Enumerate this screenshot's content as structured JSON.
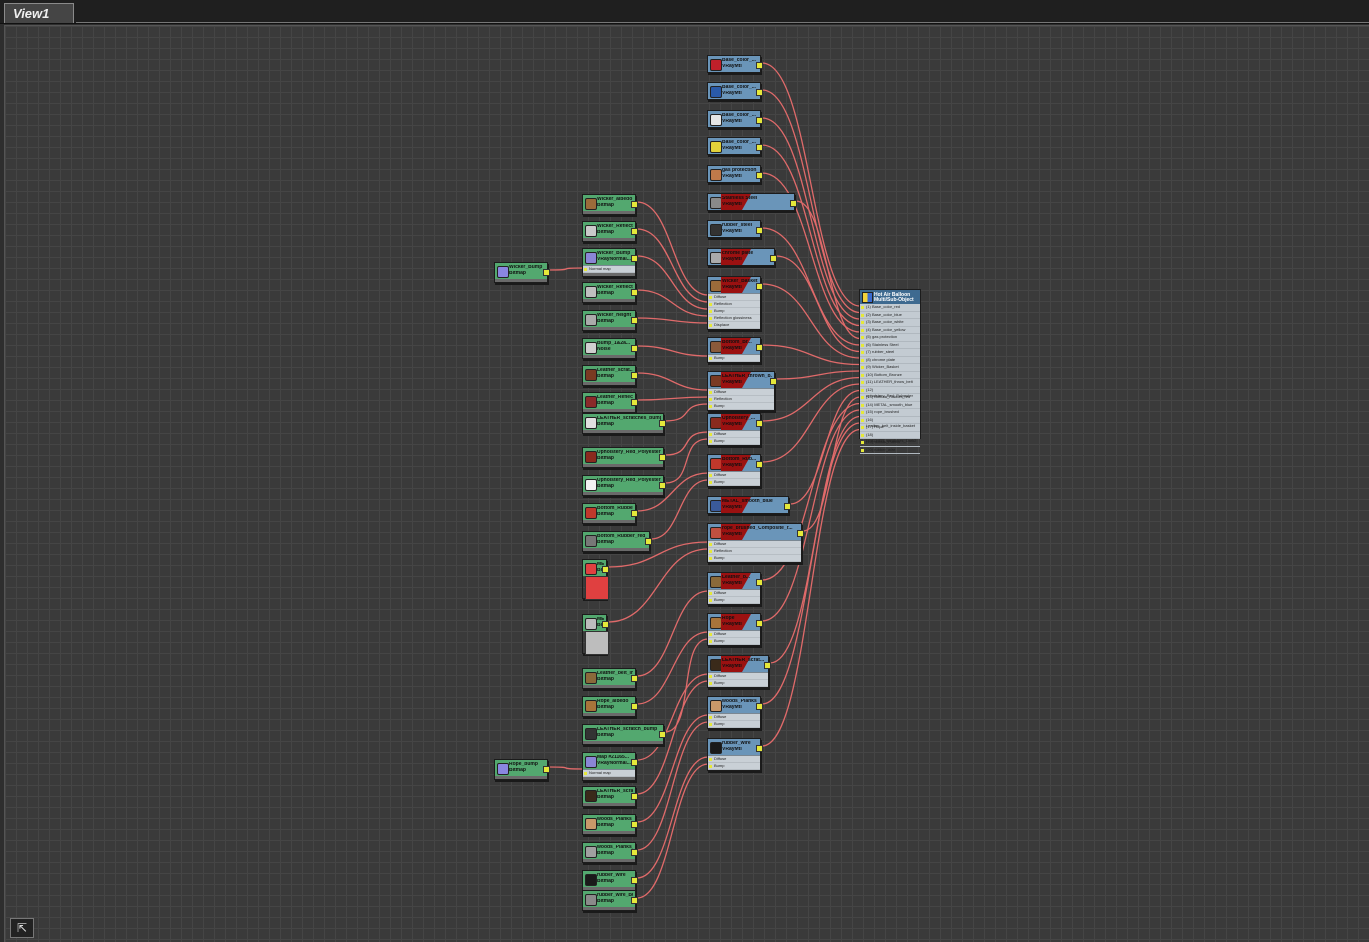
{
  "view_tab": "View1",
  "multi_node": {
    "title1": "Hot Air Balloon",
    "title2": "Multi/Sub-Object",
    "slots": [
      "(1) Base_color_red",
      "(2) Base_color_blue",
      "(3) Base_color_white",
      "(4) Base_color_yellow",
      "(5) gas protection",
      "(6) Stainless Steel",
      "(7) rubber_steel",
      "(8) chrome plate",
      "(9) Wicker_Basket",
      "(10) Bottom_Bronze",
      "(11) LEATHER_throw_belt",
      "(12) upholstery_Red_Polyester",
      "(13) Bottom_Rubber_red",
      "(14) METAL_smooth_blue",
      "(15) rope_brushed",
      "(16) Leather_belt_inside_basket",
      "(17) Rope",
      "(18) LEATHER_scratches_Dark2",
      "(19) woods_Planks",
      "(20) rubber_wire"
    ]
  },
  "bitmap_nodes": [
    {
      "t1": "Wicker_albedo",
      "t2": "Bitmap",
      "color": "#9b6b3a"
    },
    {
      "t1": "Wicker_Reflection",
      "t2": "Bitmap",
      "color": "#c9c9c9"
    },
    {
      "t1": "Wicker_Bump",
      "t2": "VRayNormal...",
      "color": "#8a86d6",
      "slot": "Normal map"
    },
    {
      "t1": "Wicker_Reflecti...",
      "t2": "Bitmap",
      "color": "#bfbfbf"
    },
    {
      "t1": "Wicker_height",
      "t2": "Bitmap",
      "color": "#aaaaaa"
    },
    {
      "t1": "Bump_1&2a...",
      "t2": "Noise",
      "color": "#cfcfcf"
    },
    {
      "t1": "Leather_scrat...",
      "t2": "Bitmap",
      "color": "#7a3a22"
    },
    {
      "t1": "Leather_Reflect...",
      "t2": "Bitmap",
      "color": "#8a2a2a"
    },
    {
      "t1": "LEATHER_scratches_bump",
      "t2": "Bitmap",
      "color": "#e0e0e0"
    },
    {
      "t1": "Upholstery_Red_Polyester",
      "t2": "Bitmap",
      "color": "#8a2a1e"
    },
    {
      "t1": "Upholstery_Red_Polyester_B...",
      "t2": "Bitmap",
      "color": "#f2f2f2"
    },
    {
      "t1": "Bottom_Rubber_red",
      "t2": "Bitmap",
      "color": "#c0382b"
    },
    {
      "t1": "Bottom_Rubber_red_b...",
      "t2": "Bitmap",
      "color": "#777777"
    },
    {
      "t1": "METAL...",
      "t2": "Bitmap",
      "color": "#e04040",
      "big": true
    },
    {
      "t1": "METAL...",
      "t2": "Bitmap",
      "color": "#bdbdbd",
      "big": true
    },
    {
      "t1": "Leather_belt_in...",
      "t2": "Bitmap",
      "color": "#8a6a3a"
    },
    {
      "t1": "Rope_albedo",
      "t2": "Bitmap",
      "color": "#a8743a"
    },
    {
      "t1": "LEATHER_scratch_bump",
      "t2": "Bitmap",
      "color": "#333333"
    },
    {
      "t1": "Map #21165...",
      "t2": "VRayNormal...",
      "color": "#8a86d6",
      "slot": "Normal map"
    },
    {
      "t1": "LEATHER_scrat...",
      "t2": "Bitmap",
      "color": "#3a2a1a"
    },
    {
      "t1": "woods_Planks",
      "t2": "Bitmap",
      "color": "#c9996a"
    },
    {
      "t1": "woods_Planks_...",
      "t2": "Bitmap",
      "color": "#a0a0a0"
    },
    {
      "t1": "rubber_wire",
      "t2": "Bitmap",
      "color": "#1a1a1a"
    },
    {
      "t1": "rubber_wire_Bu...",
      "t2": "Bitmap",
      "color": "#8a8a8a"
    }
  ],
  "bump_nodes": [
    {
      "t1": "Wicker_Bump",
      "t2": "Bitmap",
      "color": "#8a86e0"
    },
    {
      "t1": "Rope_bump",
      "t2": "Bitmap",
      "color": "#8a86e0"
    }
  ],
  "material_nodes": [
    {
      "t1": "Base_color_...",
      "t2": "VRayMtl",
      "color": "#c0202a"
    },
    {
      "t1": "Base_color_...",
      "t2": "VRayMtl",
      "color": "#2a5aa8"
    },
    {
      "t1": "Base_color_...",
      "t2": "VRayMtl",
      "color": "#e6e6e6"
    },
    {
      "t1": "Base_color_...",
      "t2": "VRayMtl",
      "color": "#e2d23a"
    },
    {
      "t1": "gas protection",
      "t2": "VRayMtl",
      "color": "#c07a4a"
    },
    {
      "t1": "Stainless Steel",
      "t2": "VRayMtl",
      "color": "#8a8a8a",
      "red": true
    },
    {
      "t1": "rubber_steel",
      "t2": "VRayMtl",
      "color": "#333333"
    },
    {
      "t1": "chrome plate",
      "t2": "VRayMtl",
      "color": "#aaaaaa",
      "red": true
    },
    {
      "t1": "Wicker_Basket",
      "t2": "VRayMtl",
      "color": "#9b6b3a",
      "red": true,
      "slots": [
        "Diffuse",
        "Reflection",
        "Bump",
        "Reflection glossiness",
        "Displace"
      ]
    },
    {
      "t1": "Bottom_Br...",
      "t2": "VRayMtl",
      "color": "#8a5a3a",
      "red": true,
      "slots": [
        "Bump"
      ]
    },
    {
      "t1": "LEATHER_thrown_b...",
      "t2": "VRayMtl",
      "color": "#7a3a22",
      "red": true,
      "slots": [
        "Diffuse",
        "Reflection",
        "Bump"
      ]
    },
    {
      "t1": "Upholstery_...",
      "t2": "VRayMtl",
      "color": "#8a2a1e",
      "red": true,
      "slots": [
        "Diffuse",
        "Bump"
      ]
    },
    {
      "t1": "Bottom_Rub...",
      "t2": "VRayMtl",
      "color": "#c0382b",
      "red": true,
      "slots": [
        "Diffuse",
        "Bump"
      ]
    },
    {
      "t1": "METAL_smooth_blue",
      "t2": "VRayMtl",
      "color": "#3a5a9a",
      "red": true
    },
    {
      "t1": "rope_brushed_Composite_r...",
      "t2": "VRayMtl",
      "color": "#c05040",
      "red": true,
      "slots": [
        "Diffuse",
        "Reflection",
        "Bump"
      ]
    },
    {
      "t1": "Leather_b...",
      "t2": "VRayMtl",
      "color": "#8a6a3a",
      "red": true,
      "slots": [
        "Diffuse",
        "Bump"
      ]
    },
    {
      "t1": "Rope",
      "t2": "VRayMtl",
      "color": "#a8743a",
      "red": true,
      "slots": [
        "Diffuse",
        "Bump"
      ]
    },
    {
      "t1": "LEATHER_scrat...",
      "t2": "VRayMtl",
      "color": "#3a2a1a",
      "red": true,
      "slots": [
        "Diffuse",
        "Bump"
      ]
    },
    {
      "t1": "woods_Planks",
      "t2": "VRayMtl",
      "color": "#c9996a",
      "slots": [
        "Diffuse",
        "Bump"
      ]
    },
    {
      "t1": "rubber_wire",
      "t2": "VRayMtl",
      "color": "#1a1a1a",
      "slots": [
        "Diffuse",
        "Bump"
      ]
    }
  ],
  "nav_icon": "navigator-icon"
}
